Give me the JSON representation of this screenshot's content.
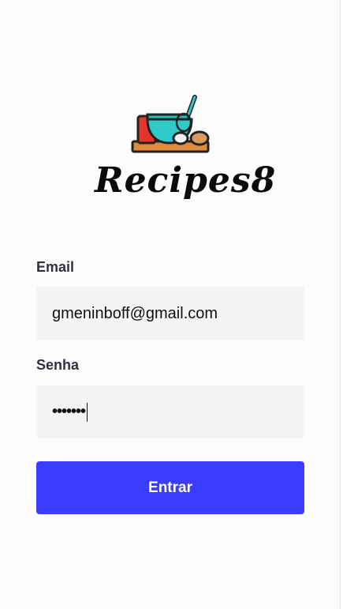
{
  "brand": {
    "name": "Recipes8",
    "logo_icon": "cooking-bowl-whisk-icon"
  },
  "form": {
    "email_label": "Email",
    "email_value": "gmeninboff@gmail.com",
    "password_label": "Senha",
    "password_value": "•••••••",
    "submit_label": "Entrar"
  },
  "colors": {
    "accent": "#3a3cff",
    "input_bg": "#f4f4f4",
    "label": "#303040"
  }
}
